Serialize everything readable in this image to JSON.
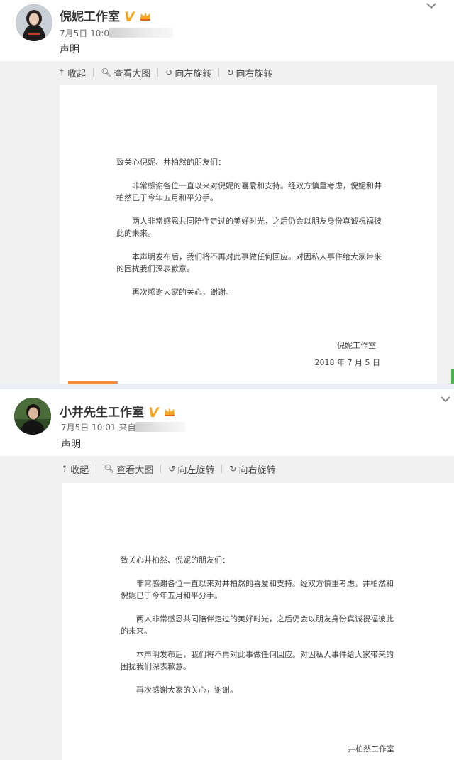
{
  "posts": [
    {
      "author": "倪妮工作室",
      "time": "7月5日 10:0",
      "text": "声明",
      "toolbar": {
        "collapse": "收起",
        "view_large": "查看大图",
        "rotate_left": "向左旋转",
        "rotate_right": "向右旋转"
      },
      "letter": {
        "greeting": "致关心倪妮、井柏然的朋友们：",
        "paragraphs": [
          "非常感谢各位一直以来对倪妮的喜爱和支持。经双方慎重考虑，倪妮和井柏然已于今年五月和平分手。",
          "两人非常感恩共同陪伴走过的美好时光，之后仍会以朋友身份真诚祝福彼此的未来。",
          "本声明发布后，我们将不再对此事做任何回应。对因私人事件给大家带来的困扰我们深表歉意。",
          "再次感谢大家的关心，谢谢。"
        ],
        "signature": "倪妮工作室",
        "date": "2018 年 7 月 5 日"
      }
    },
    {
      "author": "小井先生工作室",
      "time": "7月5日 10:01 来自",
      "text": "声明",
      "toolbar": {
        "collapse": "收起",
        "view_large": "查看大图",
        "rotate_left": "向左旋转",
        "rotate_right": "向右旋转"
      },
      "letter": {
        "greeting": "致关心井柏然、倪妮的朋友们：",
        "paragraphs": [
          "非常感谢各位一直以来对井柏然的喜爱和支持。经双方慎重考虑，井柏然和倪妮已于今年五月和平分手。",
          "两人非常感恩共同陪伴走过的美好时光，之后仍会以朋友身份真诚祝福彼此的未来。",
          "本声明发布后，我们将不再对此事做任何回应。对因私人事件给大家带来的困扰我们深表歉意。",
          "再次感谢大家的关心，谢谢。"
        ],
        "signature": "井柏然工作室"
      }
    }
  ],
  "badge_color": "#f5a623"
}
